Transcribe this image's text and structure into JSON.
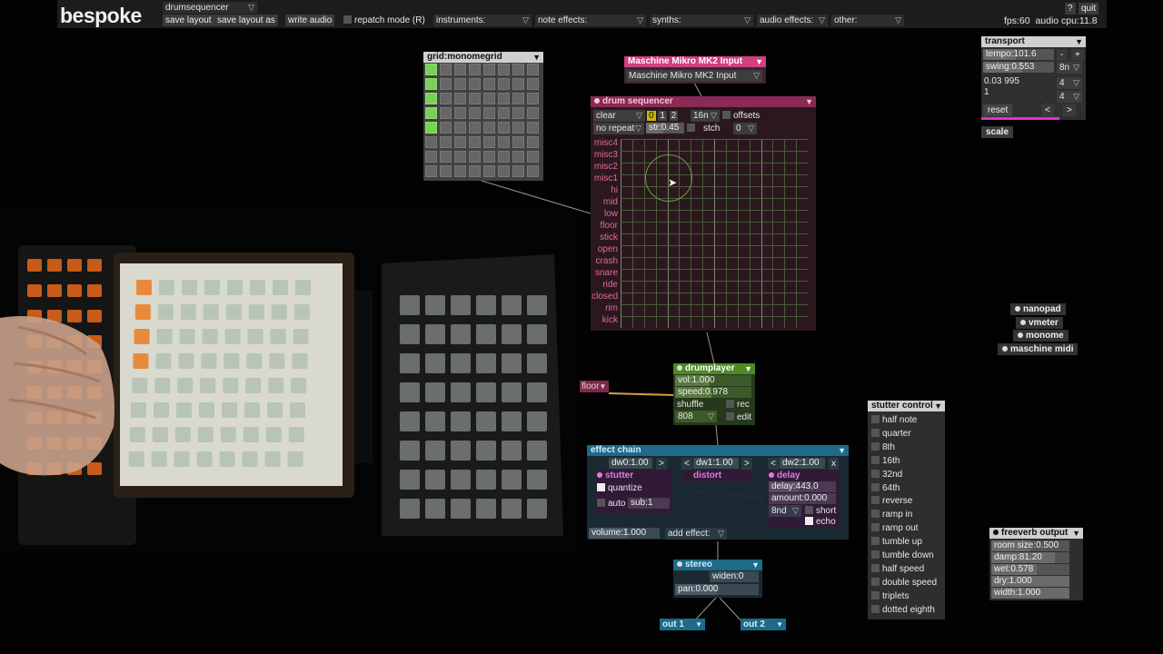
{
  "app": {
    "name": "bespoke",
    "fps": "fps:60",
    "cpu": "audio cpu:11.8",
    "help": "?",
    "quit": "quit"
  },
  "topbar": {
    "layout_select": "drumsequencer",
    "save_layout": "save layout",
    "save_layout_as": "save layout as",
    "write_audio": "write audio",
    "repatch_mode": "repatch mode (R)",
    "menus": [
      {
        "label": "instruments:"
      },
      {
        "label": "note effects:"
      },
      {
        "label": "synths:"
      },
      {
        "label": "audio effects:"
      },
      {
        "label": "other:"
      }
    ]
  },
  "grid_module": {
    "title": "grid:monomegrid",
    "lit_rows": [
      0,
      1,
      2,
      3,
      4
    ]
  },
  "maschine_input": {
    "title": "Maschine Mikro MK2 Input",
    "device": "Maschine Mikro MK2 Input"
  },
  "drum_sequencer": {
    "title": "drum sequencer",
    "clear": "clear",
    "pages": [
      "0",
      "1",
      "2"
    ],
    "interval": "16n",
    "offsets": "offsets",
    "no_repeat": "no repeat",
    "strength": "str:0.45",
    "stch": "stch",
    "stch_value": "0",
    "rows": [
      "misc4",
      "misc3",
      "misc2",
      "misc1",
      "hi",
      "mid",
      "low",
      "floor",
      "stick",
      "open",
      "crash",
      "snare",
      "ride",
      "closed",
      "rim",
      "kick"
    ]
  },
  "floor_node": {
    "label": "floor"
  },
  "drumplayer": {
    "title": "drumplayer",
    "vol": "vol:1.000",
    "speed": "speed:0.978",
    "shuffle": "shuffle",
    "rec": "rec",
    "kit": "808",
    "edit": "edit"
  },
  "effect_chain": {
    "title": "effect chain",
    "dw0": "dw0:1.00",
    "dw1": "dw1:1.00",
    "dw2": "dw2:1.00",
    "prev": "<",
    "next": ">",
    "close": "x",
    "stutter": {
      "title": "stutter",
      "quantize": "quantize",
      "auto": "auto",
      "sub": "sub:1"
    },
    "distort": {
      "title": "distort"
    },
    "delay": {
      "title": "delay",
      "delay": "delay:443.0",
      "amount": "amount:0.000",
      "interval": "8nd",
      "short": "short",
      "echo": "echo"
    },
    "volume": "volume:1.000",
    "add_effect": "add effect:"
  },
  "stereo": {
    "title": "stereo",
    "widen": "widen:0",
    "pan": "pan:0.000"
  },
  "outputs": [
    {
      "label": "out 1"
    },
    {
      "label": "out 2"
    }
  ],
  "transport": {
    "title": "transport",
    "tempo": "tempo:101.6",
    "swing": "swing:0.553",
    "minus": "-",
    "plus": "+",
    "interval": "8n",
    "timesig_top": "4",
    "timesig_bottom": "4",
    "measure_pos": "0.03 995",
    "measure_num": "1",
    "reset": "reset",
    "back": "<",
    "fwd": ">"
  },
  "scale": {
    "label": "scale"
  },
  "controllers": [
    {
      "label": "nanopad"
    },
    {
      "label": "vmeter"
    },
    {
      "label": "monome"
    },
    {
      "label": "maschine midi"
    }
  ],
  "stutter_control": {
    "title": "stutter control",
    "items": [
      "half note",
      "quarter",
      "8th",
      "16th",
      "32nd",
      "64th",
      "reverse",
      "ramp in",
      "ramp out",
      "tumble up",
      "tumble down",
      "half speed",
      "double speed",
      "triplets",
      "dotted eighth"
    ]
  },
  "freeverb": {
    "title": "freeverb output",
    "room_size": "room size:0.500",
    "damp": "damp:81.20",
    "wet": "wet:0.578",
    "dry": "dry:1.000",
    "width": "width:1.000"
  },
  "colors": {
    "accent_pink": "#e0458f",
    "green": "#5cb030",
    "teal": "#3aa8c8",
    "orange": "#e07a2a"
  }
}
